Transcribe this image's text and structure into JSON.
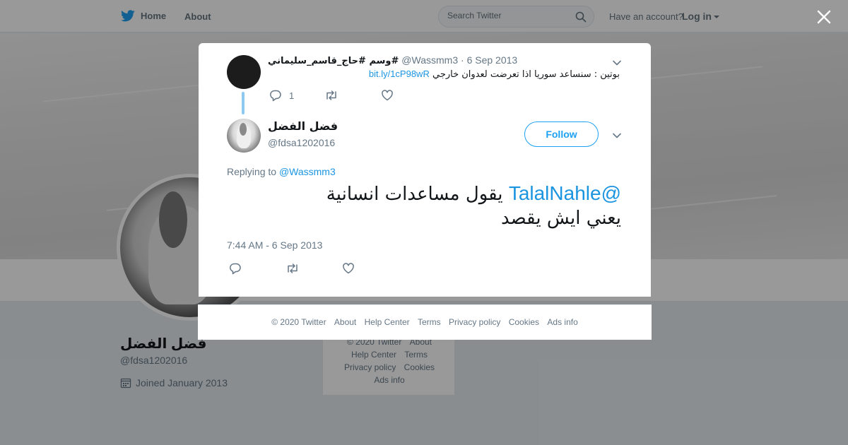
{
  "topbar": {
    "home_label": "Home",
    "about_label": "About",
    "search_placeholder": "Search Twitter",
    "have_account": "Have an account?",
    "login_label": "Log in"
  },
  "profile": {
    "name": "فضل الفضل",
    "handle": "@fdsa1202016",
    "joined": "Joined January 2013"
  },
  "background_footer": {
    "links": [
      "© 2020 Twitter",
      "About",
      "Help Center",
      "Terms",
      "Privacy policy",
      "Cookies",
      "Ads info"
    ]
  },
  "parent_tweet": {
    "name": "وسم #حاج_قاسم_سليماني#",
    "handle": "@Wassmm3",
    "separator": "·",
    "date": "6 Sep 2013",
    "text": "بوتين : سنساعد سوريا اذا تعرضت لعدوان خارجي",
    "link": "bit.ly/1cP98wR",
    "reply_count": "1"
  },
  "main_tweet": {
    "author_name": "فضل الفضل",
    "author_handle": "@fdsa1202016",
    "follow_label": "Follow",
    "replying_prefix": "Replying to",
    "replying_to": "@Wassmm3",
    "mention": "@TalalNahle",
    "text_line1": "يقول مساعدات انسانية",
    "text_line2": "يعني ايش يقصد",
    "timestamp": "7:44 AM - 6 Sep 2013"
  },
  "modal_footer": {
    "links": [
      "© 2020 Twitter",
      "About",
      "Help Center",
      "Terms",
      "Privacy policy",
      "Cookies",
      "Ads info"
    ]
  },
  "colors": {
    "twitter_blue": "#1da1f2",
    "link_blue": "#1b95e0",
    "thread_line": "#8ec9f0",
    "muted_text": "#657786"
  },
  "icons": [
    "twitter-bird-icon",
    "search-icon",
    "caret-down-icon",
    "close-icon",
    "chevron-down-icon",
    "reply-icon",
    "retweet-icon",
    "like-icon",
    "calendar-icon"
  ]
}
